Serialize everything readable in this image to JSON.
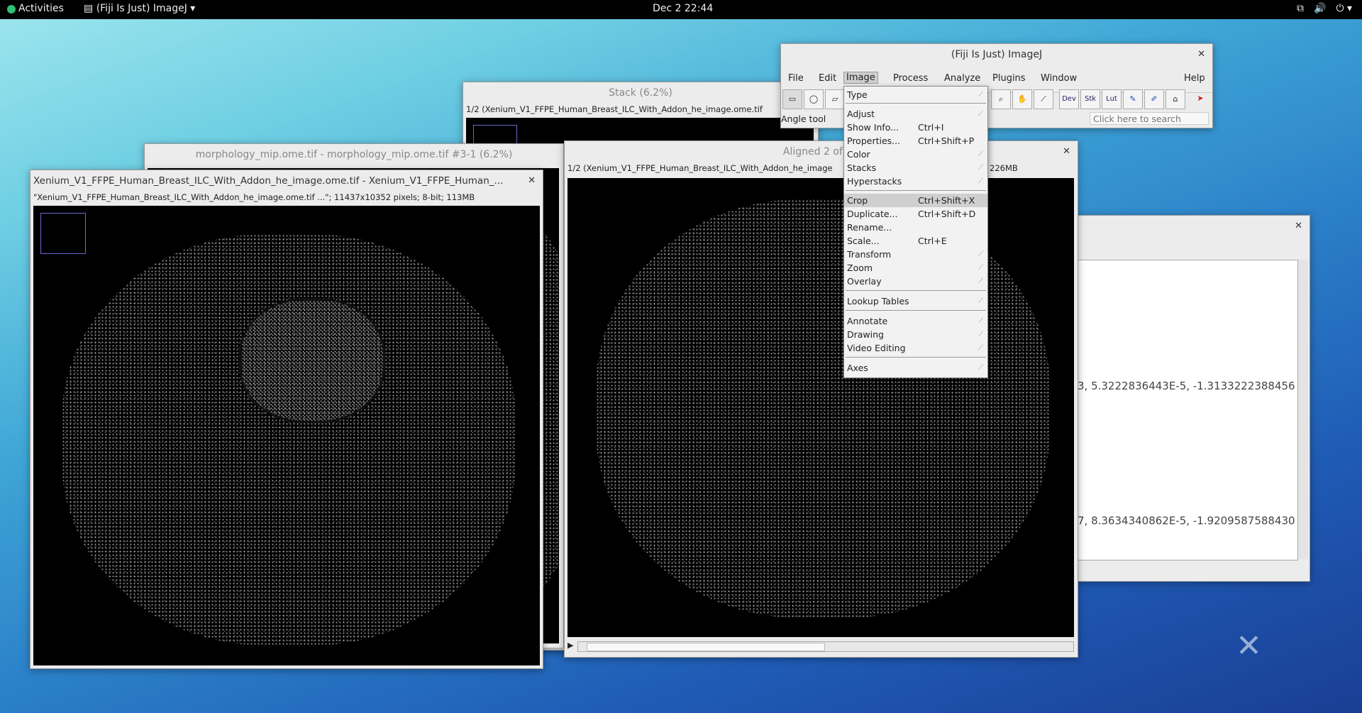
{
  "topbar": {
    "activities": "Activities",
    "app_menu": "(Fiji Is Just) ImageJ",
    "clock": "Dec 2  22:44"
  },
  "imagej_main": {
    "title": "(Fiji Is Just) ImageJ",
    "menus": [
      "File",
      "Edit",
      "Image",
      "Process",
      "Analyze",
      "Plugins",
      "Window",
      "Help"
    ],
    "status": "Angle tool",
    "search_placeholder": "Click here to search",
    "tool_labels": [
      "Dev",
      "Stk",
      "Lut"
    ]
  },
  "image_menu": {
    "items": [
      {
        "label": "Type",
        "shortcut": "",
        "submenu": true
      },
      {
        "label": "Adjust",
        "shortcut": "",
        "submenu": true
      },
      {
        "label": "Show Info...",
        "shortcut": "Ctrl+I",
        "submenu": false
      },
      {
        "label": "Properties...",
        "shortcut": "Ctrl+Shift+P",
        "submenu": false
      },
      {
        "label": "Color",
        "shortcut": "",
        "submenu": true
      },
      {
        "label": "Stacks",
        "shortcut": "",
        "submenu": true
      },
      {
        "label": "Hyperstacks",
        "shortcut": "",
        "submenu": true
      },
      {
        "label": "Crop",
        "shortcut": "Ctrl+Shift+X",
        "submenu": false
      },
      {
        "label": "Duplicate...",
        "shortcut": "Ctrl+Shift+D",
        "submenu": false
      },
      {
        "label": "Rename...",
        "shortcut": "",
        "submenu": false
      },
      {
        "label": "Scale...",
        "shortcut": "Ctrl+E",
        "submenu": false
      },
      {
        "label": "Transform",
        "shortcut": "",
        "submenu": true
      },
      {
        "label": "Zoom",
        "shortcut": "",
        "submenu": true
      },
      {
        "label": "Overlay",
        "shortcut": "",
        "submenu": true
      },
      {
        "label": "Lookup Tables",
        "shortcut": "",
        "submenu": true
      },
      {
        "label": "Annotate",
        "shortcut": "",
        "submenu": true
      },
      {
        "label": "Drawing",
        "shortcut": "",
        "submenu": true
      },
      {
        "label": "Video Editing",
        "shortcut": "",
        "submenu": true
      },
      {
        "label": "Axes",
        "shortcut": "",
        "submenu": true
      }
    ],
    "highlighted": "Crop"
  },
  "stack_window": {
    "title": "Stack (6.2%)",
    "info": "1/2 (Xenium_V1_FFPE_Human_Breast_ILC_With_Addon_he_image.ome.tif"
  },
  "morph_window": {
    "title": "morphology_mip.ome.tif - morphology_mip.ome.tif #3-1 (6.2%)"
  },
  "he_window": {
    "title": "Xenium_V1_FFPE_Human_Breast_ILC_With_Addon_he_image.ome.tif - Xenium_V1_FFPE_Human_...",
    "info": "\"Xenium_V1_FFPE_Human_Breast_ILC_With_Addon_he_image.ome.tif ...\"; 11437x10352 pixels; 8-bit; 113MB"
  },
  "aligned_window": {
    "title": "Aligned 2 of 2 (",
    "info_left": "1/2 (Xenium_V1_FFPE_Human_Breast_ILC_With_Addon_he_image",
    "info_right": "8-bit; 226MB"
  },
  "log_window": {
    "line1": "3, 5.3222836443E-5, -1.3133222388456",
    "line2": "7, 8.3634340862E-5, -1.9209587588430"
  },
  "colors": {
    "topbar": "#000000",
    "window_bg": "#ececec",
    "menu_highlight": "#cfcfcf",
    "canvas": "#000000"
  }
}
